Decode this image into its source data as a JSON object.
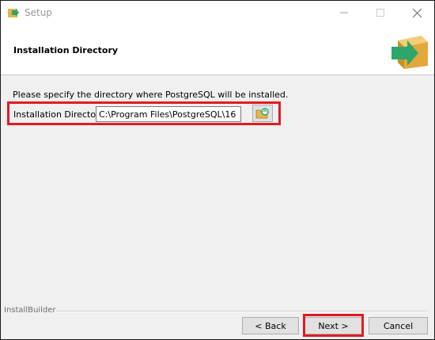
{
  "window": {
    "title": "Setup",
    "app_icon": "installer-icon",
    "controls": [
      "minimize-icon",
      "maximize-icon",
      "close-icon"
    ]
  },
  "header": {
    "title": "Installation Directory",
    "logo_icon": "box-arrow-icon"
  },
  "content": {
    "description": "Please specify the directory where PostgreSQL will be installed.",
    "directory_label": "Installation Directory",
    "directory_value": "C:\\Program Files\\PostgreSQL\\16",
    "browse_icon": "folder-browse-icon"
  },
  "footer": {
    "brand": "InstallBuilder",
    "back_label": "< Back",
    "next_label": "Next >",
    "cancel_label": "Cancel"
  },
  "colors": {
    "highlight": "#e11b22",
    "arrow_green": "#2da66b",
    "box_tan": "#e8b54d"
  }
}
